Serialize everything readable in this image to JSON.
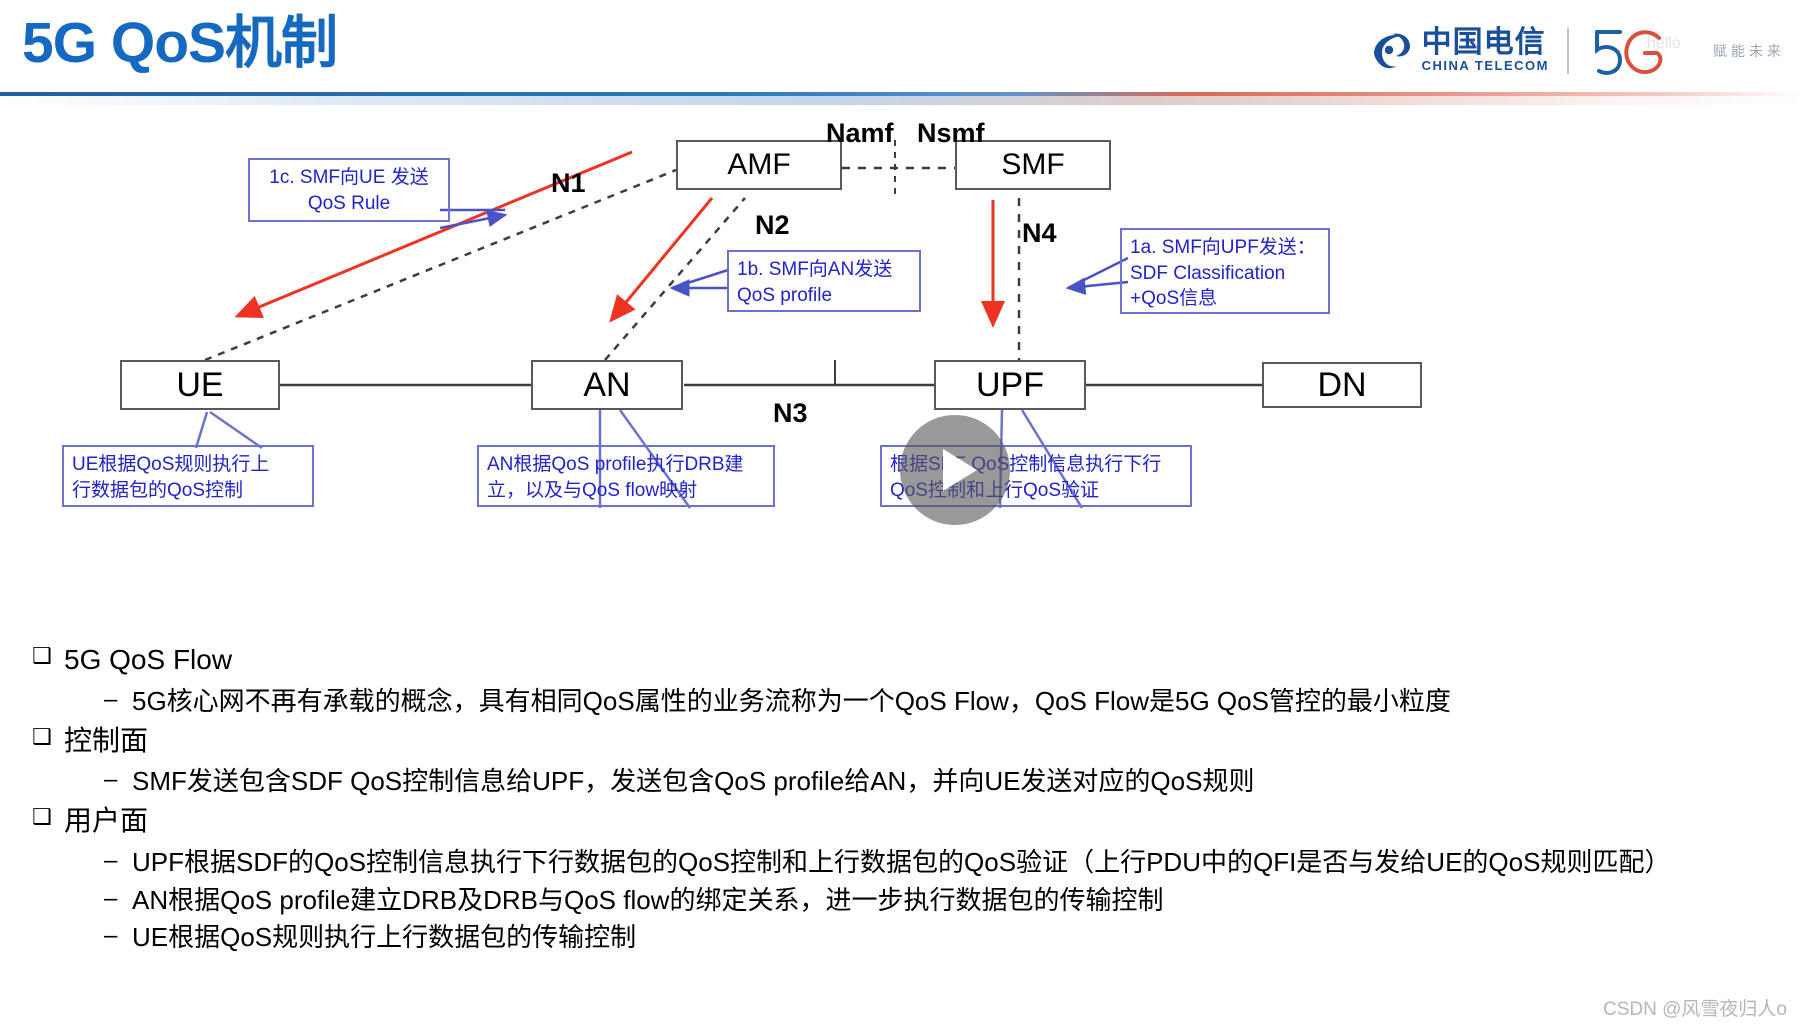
{
  "header": {
    "title": "5G QoS机制",
    "logo": {
      "company_cn": "中国电信",
      "company_en": "CHINA TELECOM",
      "fiveg_mark": "5G",
      "fiveg_word": "hello",
      "slogan": "赋能未来"
    }
  },
  "diagram": {
    "nodes": [
      {
        "id": "ue",
        "label": "UE"
      },
      {
        "id": "an",
        "label": "AN"
      },
      {
        "id": "upf",
        "label": "UPF"
      },
      {
        "id": "dn",
        "label": "DN"
      },
      {
        "id": "amf",
        "label": "AMF"
      },
      {
        "id": "smf",
        "label": "SMF"
      }
    ],
    "interfaces": [
      {
        "id": "n1",
        "label": "N1"
      },
      {
        "id": "n2",
        "label": "N2"
      },
      {
        "id": "n3",
        "label": "N3"
      },
      {
        "id": "n4",
        "label": "N4"
      },
      {
        "id": "namf",
        "label": "Namf"
      },
      {
        "id": "nsmf",
        "label": "Nsmf"
      }
    ],
    "callouts": [
      {
        "id": "c1c",
        "text": "1c. SMF向UE 发送\nQoS Rule"
      },
      {
        "id": "c1b",
        "text": "1b. SMF向AN发送\nQoS profile"
      },
      {
        "id": "c1a",
        "text": "1a. SMF向UPF发送：\nSDF Classification\n+QoS信息"
      },
      {
        "id": "c-ue",
        "text": "UE根据QoS规则执行上\n行数据包的QoS控制"
      },
      {
        "id": "c-an",
        "text": "AN根据QoS profile执行DRB建\n立，以及与QoS flow映射"
      },
      {
        "id": "c-upf",
        "text": "根据SDF QoS控制信息执行下行\nQoS控制和上行QoS验证"
      }
    ],
    "play_button": "play-icon"
  },
  "bullets": [
    {
      "level1": "5G QoS Flow",
      "level2": [
        "5G核心网不再有承载的概念，具有相同QoS属性的业务流称为一个QoS Flow，QoS Flow是5G QoS管控的最小粒度"
      ]
    },
    {
      "level1": "控制面",
      "level2": [
        "SMF发送包含SDF QoS控制信息给UPF，发送包含QoS profile给AN，并向UE发送对应的QoS规则"
      ]
    },
    {
      "level1": "用户面",
      "level2": [
        "UPF根据SDF的QoS控制信息执行下行数据包的QoS控制和上行数据包的QoS验证（上行PDU中的QFI是否与发给UE的QoS规则匹配）",
        "AN根据QoS profile建立DRB及DRB与QoS flow的绑定关系，进一步执行数据包的传输控制",
        "UE根据QoS规则执行上行数据包的传输控制"
      ]
    }
  ],
  "markers": {
    "level1": "❑",
    "level2": "–"
  },
  "watermark": "CSDN @风雪夜归人o",
  "colors": {
    "title_blue": "#1569c0",
    "callout_blue": "#2222cc",
    "callout_border": "#6b72cf",
    "arrow_red": "#ee3322",
    "node_border": "#595959",
    "logo_blue": "#1b4f9c"
  }
}
